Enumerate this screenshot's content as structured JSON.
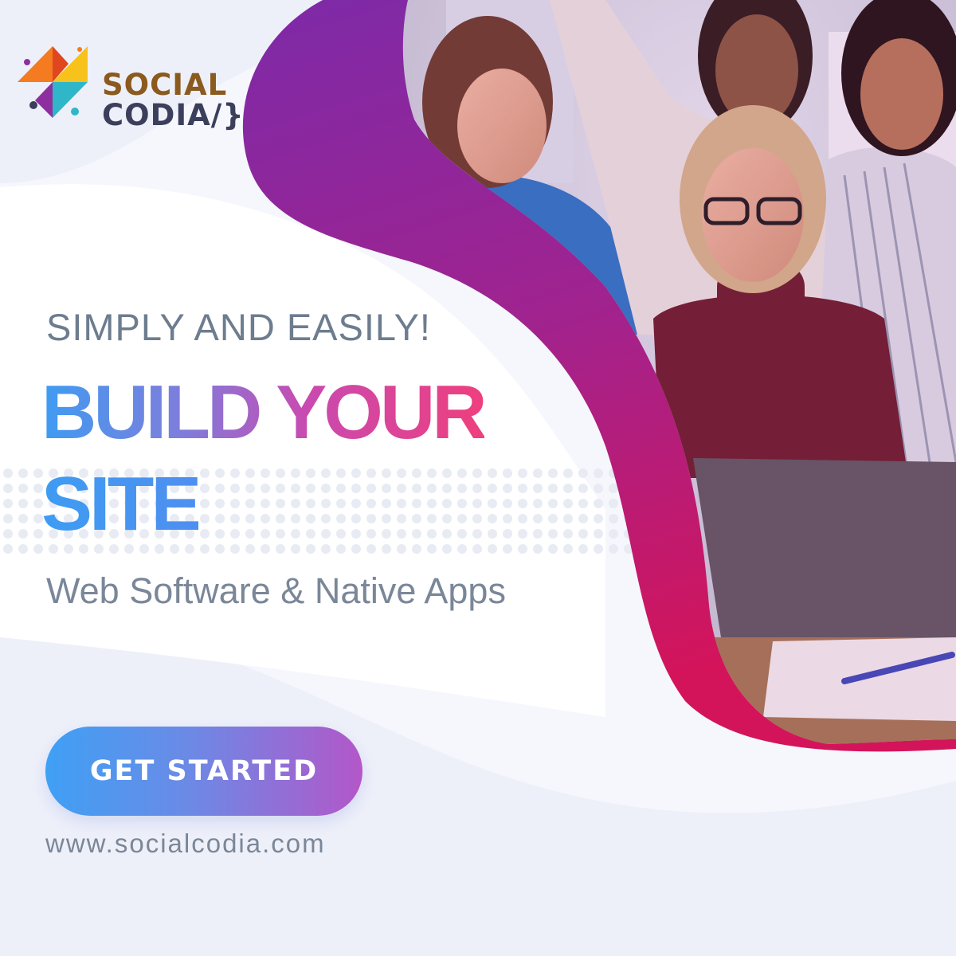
{
  "brand": {
    "name_line1": "SOCIAL",
    "name_line2": "CODIA/}",
    "colors": {
      "orange": "#f47b20",
      "yellow": "#f7c21b",
      "teal": "#2fb6c8",
      "purple": "#8e2fa0",
      "navy": "#3b3f5c"
    }
  },
  "hero": {
    "tagline": "SIMPLY AND EASILY!",
    "headline_line1": "BUILD YOUR",
    "headline_line2": "SITE",
    "subheadline": "Web Software & Native Apps"
  },
  "cta": {
    "label": "GET STARTED"
  },
  "footer": {
    "url": "www.socialcodia.com"
  },
  "photo": {
    "subject": "four-women-at-laptop-photo"
  },
  "colors": {
    "accent_blue": "#3e9cf2",
    "accent_pink": "#ee3f7e",
    "accent_purple": "#8a2aa8",
    "text_gray": "#6d7d8f"
  }
}
